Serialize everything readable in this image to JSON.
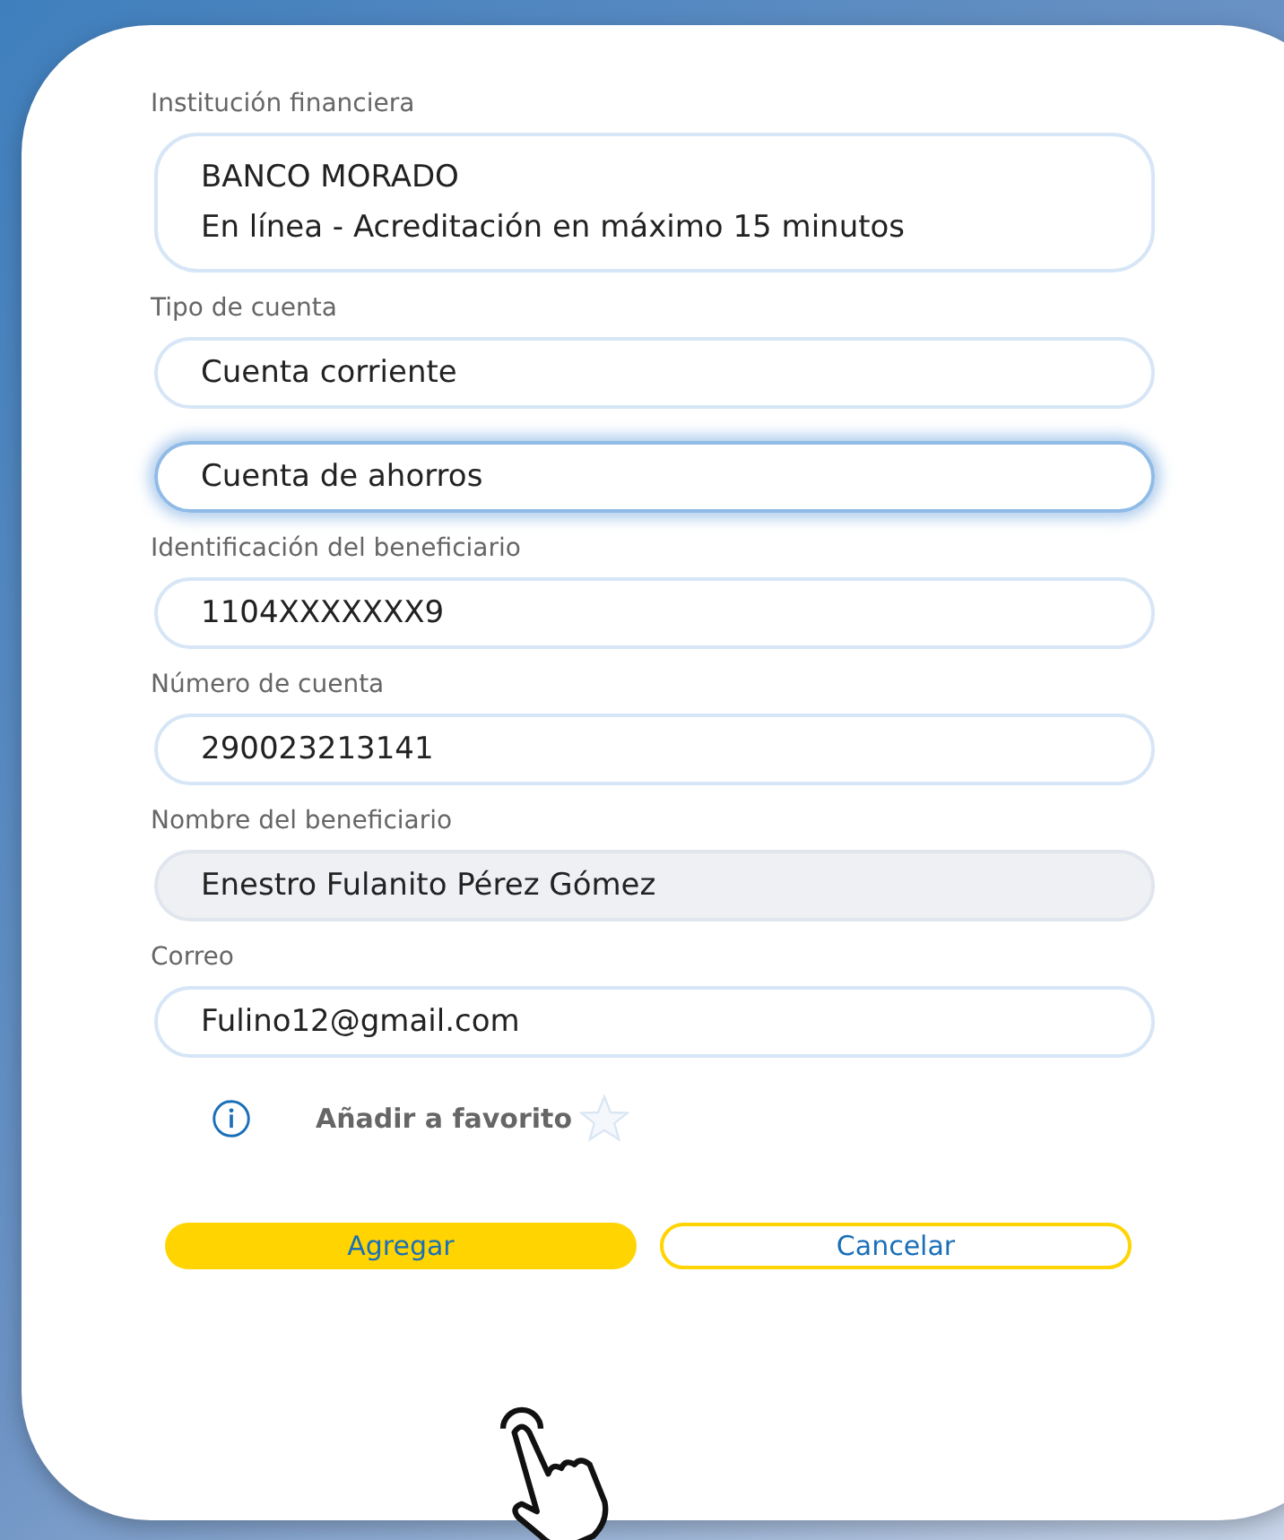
{
  "fields": [
    {
      "label": "Institución financiera",
      "kind": "multiline",
      "lines": [
        "BANCO MORADO",
        "En línea - Acreditación en máximo 15 minutos"
      ]
    },
    {
      "label": "Tipo de cuenta",
      "kind": "options",
      "options": [
        {
          "text": "Cuenta corriente",
          "selected": false
        },
        {
          "text": "Cuenta de ahorros",
          "selected": true
        }
      ]
    },
    {
      "label": "Identificación del beneficiario",
      "kind": "input",
      "value": "1104XXXXXXX9",
      "disabled": false
    },
    {
      "label": "Número de cuenta",
      "kind": "input",
      "value": "290023213141",
      "disabled": false
    },
    {
      "label": "Nombre del beneficiario",
      "kind": "input",
      "value": "Enestro Fulanito Pérez Gómez",
      "disabled": true
    },
    {
      "label": "Correo",
      "kind": "input",
      "value": "Fulino12@gmail.com",
      "disabled": false
    }
  ],
  "favorite": {
    "label": "Añadir a favorito",
    "checked": false
  },
  "buttons": [
    {
      "label": "Agregar",
      "kind": "primary"
    },
    {
      "label": "Cancelar",
      "kind": "secondary"
    }
  ]
}
